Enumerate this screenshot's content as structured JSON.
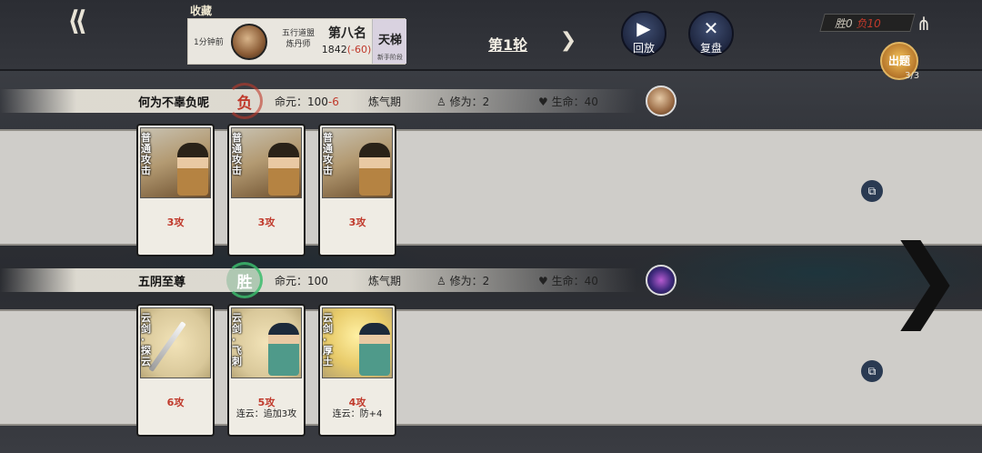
{
  "header": {
    "favorite_label": "收藏",
    "record": {
      "time": "1分钟前",
      "sect_line1": "五行道盟",
      "sect_line2": "炼丹师",
      "rank": "第八名",
      "score": "1842",
      "score_delta": "(-60)",
      "ladder_title": "天梯",
      "ladder_sub": "新手阶段"
    },
    "round_label": "第1轮",
    "replay_label": "回放",
    "review_label": "复盘",
    "wins": "胜0",
    "losses": "负10",
    "deploy_label": "出题",
    "deploy_count": "3/3"
  },
  "players": [
    {
      "name": "何为不辜负呢",
      "result": "负",
      "hp_label": "命元：",
      "hp_value": "100",
      "hp_delta": "-6",
      "realm": "炼气期",
      "cultivation": "修为：2",
      "life": "生命：40",
      "cards": [
        {
          "title": "普通攻击",
          "attack": "3攻",
          "extra": ""
        },
        {
          "title": "普通攻击",
          "attack": "3攻",
          "extra": ""
        },
        {
          "title": "普通攻击",
          "attack": "3攻",
          "extra": ""
        }
      ]
    },
    {
      "name": "五阴至尊",
      "result": "胜",
      "hp_label": "命元：",
      "hp_value": "100",
      "hp_delta": "",
      "realm": "炼气期",
      "cultivation": "修为：2",
      "life": "生命：40",
      "cards": [
        {
          "title": "云剑·探云",
          "attack": "6攻",
          "extra": ""
        },
        {
          "title": "云剑·飞刺",
          "attack": "5攻",
          "extra": "连云：追加3攻"
        },
        {
          "title": "云剑·厚土",
          "attack": "4攻",
          "extra": "连云：防+4"
        }
      ]
    }
  ],
  "icons": {
    "back": "back-arrow-icon",
    "round_next": "chevron-right-icon",
    "replay": "play-icon",
    "review": "cross-swords-icon",
    "share": "share-icon",
    "copy": "copy-icon",
    "next_page": "big-chevron-right-icon"
  },
  "colors": {
    "loss": "#c0392b",
    "win": "#3cbe6e",
    "button_blue": "#2a3a5e"
  }
}
